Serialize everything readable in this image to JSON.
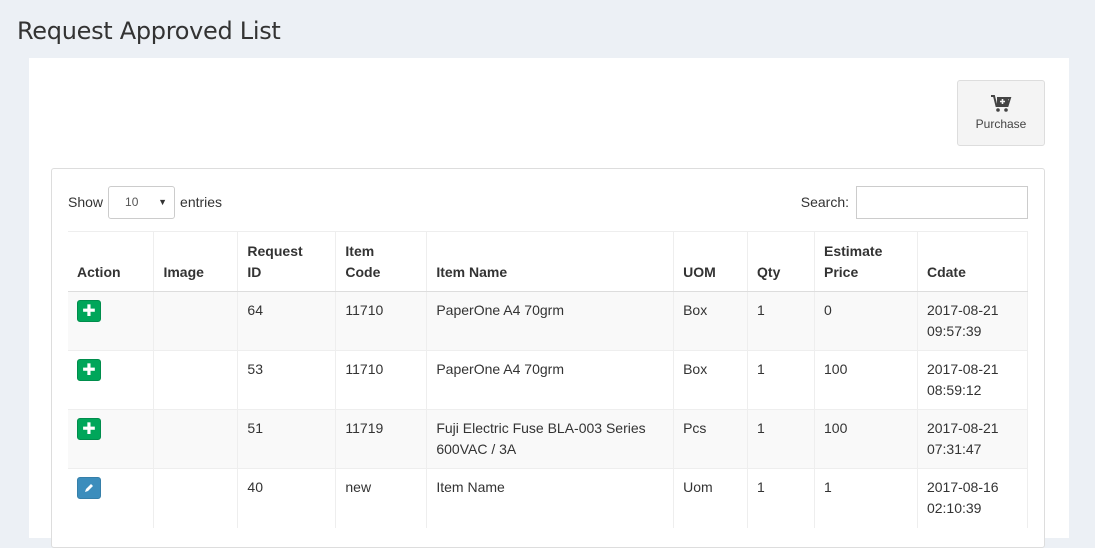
{
  "page": {
    "title": "Request Approved List"
  },
  "toolbar": {
    "purchase_label": "Purchase"
  },
  "table_controls": {
    "show_label": "Show",
    "entries_value": "10",
    "entries_label": "entries",
    "search_label": "Search:"
  },
  "table": {
    "headers": {
      "action": "Action",
      "image": "Image",
      "request_id": "Request ID",
      "item_code": "Item Code",
      "item_name": "Item Name",
      "uom": "UOM",
      "qty": "Qty",
      "estimate_price": "Estimate Price",
      "cdate": "Cdate"
    },
    "rows": [
      {
        "action": "add",
        "request_id": "64",
        "item_code": "11710",
        "item_name": "PaperOne A4 70grm",
        "uom": "Box",
        "qty": "1",
        "estimate_price": "0",
        "cdate_date": "2017-08-21",
        "cdate_time": "09:57:39"
      },
      {
        "action": "add",
        "request_id": "53",
        "item_code": "11710",
        "item_name": "PaperOne A4 70grm",
        "uom": "Box",
        "qty": "1",
        "estimate_price": "100",
        "cdate_date": "2017-08-21",
        "cdate_time": "08:59:12"
      },
      {
        "action": "add",
        "request_id": "51",
        "item_code": "11719",
        "item_name": "Fuji Electric Fuse BLA-003 Series 600VAC / 3A",
        "uom": "Pcs",
        "qty": "1",
        "estimate_price": "100",
        "cdate_date": "2017-08-21",
        "cdate_time": "07:31:47"
      },
      {
        "action": "edit",
        "request_id": "40",
        "item_code": "new",
        "item_name": "Item Name",
        "uom": "Uom",
        "qty": "1",
        "estimate_price": "1",
        "cdate_date": "2017-08-16",
        "cdate_time": "02:10:39"
      }
    ]
  },
  "colors": {
    "add": "#00a65a",
    "edit": "#3c8dbc",
    "background": "#ecf0f5"
  },
  "icons": {
    "purchase": "cart-plus-icon",
    "add": "plus-icon",
    "edit": "pencil-icon"
  }
}
